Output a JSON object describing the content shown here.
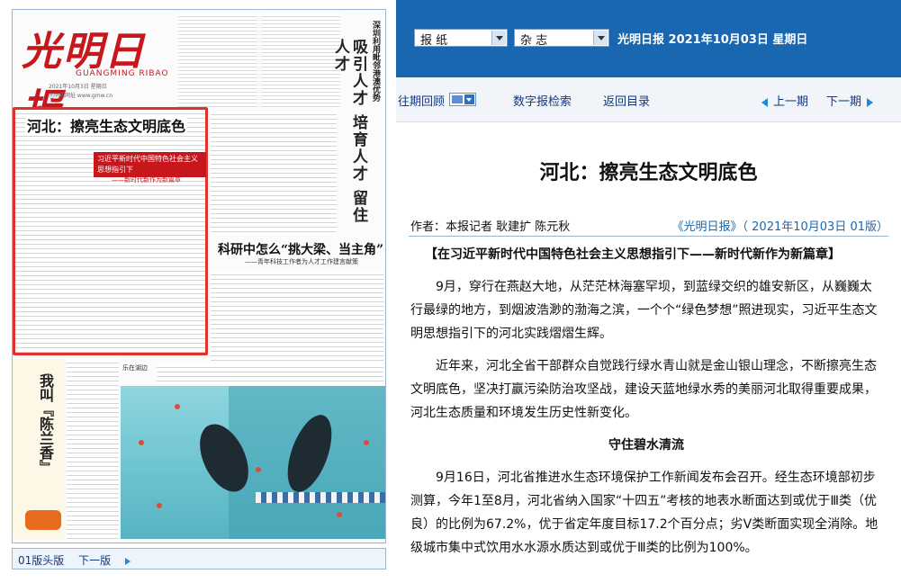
{
  "paper": {
    "masthead": "光明日报",
    "masthead_en": "GUANGMING RIBAO",
    "masthead_date": "2021年10月3日 星期日",
    "masthead_site": "光明网网址 www.gmw.cn",
    "lead_title": "河北：擦亮生态文明底色",
    "banner_text": "习近平新时代中国特色社会主义思想指引下",
    "banner_sub": "——新时代新作为新篇章",
    "vertical_small": "深圳利用毗邻港澳优势",
    "vertical_headline": "吸引人才 培育人才 留住人才",
    "feature_title": "科研中怎么“挑大梁、当主角”",
    "feature_sub": "——青年科技工作者为人才工作建言献策",
    "side_title": "我叫『陈兰香』",
    "photo_label": "乐在湖边"
  },
  "bottom_nav": {
    "page_label": "01版头版",
    "next_label": "下一版"
  },
  "topbar": {
    "select_newspaper": "报  纸",
    "select_magazine": "杂  志",
    "date_text": "光明日报  2021年10月03日  星期日",
    "accent": "#1a67b1"
  },
  "nav": {
    "past_review": "往期回顾",
    "digital_search": "数字报检索",
    "back_to_index": "返回目录",
    "prev_issue": "上一期",
    "next_issue": "下一期"
  },
  "article": {
    "title": "河北：擦亮生态文明底色",
    "author": "作者：本报记者  耿建扩  陈元秋",
    "source": "《光明日报》（ 2021年10月03日   01版）",
    "intro": "【在习近平新时代中国特色社会主义思想指引下——新时代新作为新篇章】",
    "paragraphs": [
      "9月，穿行在燕赵大地，从茫茫林海塞罕坝，到蓝绿交织的雄安新区，从巍巍太行最绿的地方，到烟波浩渺的渤海之滨，一个个“绿色梦想”照进现实，习近平生态文明思想指引下的河北实践熠熠生辉。",
      "近年来，河北全省干部群众自觉践行绿水青山就是金山银山理念，不断擦亮生态文明底色，坚决打赢污染防治攻坚战，建设天蓝地绿水秀的美丽河北取得重要成果，河北生态质量和环境发生历史性新变化。"
    ],
    "subheading": "守住碧水清流",
    "paragraph3": "9月16日，河北省推进水生态环境保护工作新闻发布会召开。经生态环境部初步测算，今年1至8月，河北省纳入国家“十四五”考核的地表水断面达到或优于Ⅲ类（优良）的比例为67.2%，优于省定年度目标17.2个百分点；劣Ⅴ类断面实现全消除。地级城市集中式饮用水水源水质达到或优于Ⅲ类的比例为100%。"
  }
}
